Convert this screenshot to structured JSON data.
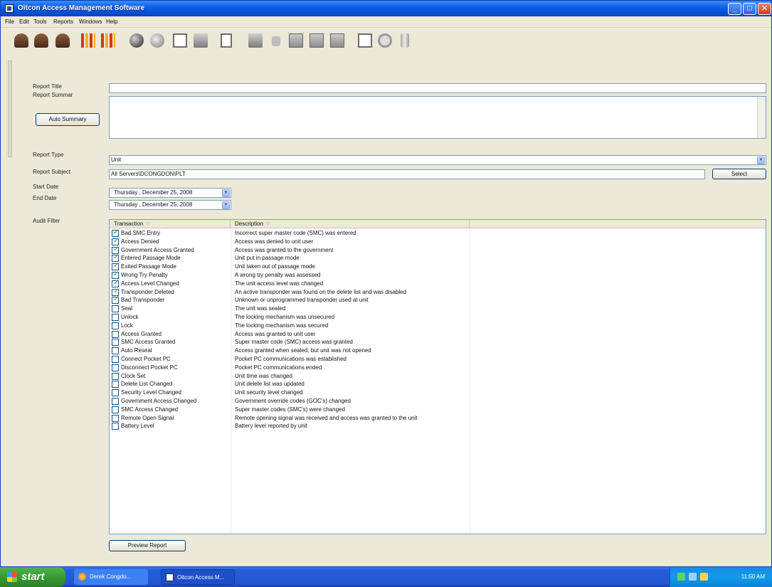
{
  "window": {
    "title": "Oitcon Access Management Software",
    "buttons": {
      "minimize": "_",
      "maximize": "□",
      "close": "✕"
    }
  },
  "menu": [
    "File",
    "Edit",
    "Tools",
    "Reports",
    "Windows",
    "Help"
  ],
  "toolbar": {
    "icons": [
      "users-icon",
      "user-icon",
      "user-remove-icon",
      "chart-icon",
      "chart-alt-icon",
      "globe-icon",
      "disc-icon",
      "document-icon",
      "document-dark-icon",
      "handheld-icon",
      "transfer-icon",
      "lock-icon",
      "server-icon",
      "server-add-icon",
      "server-list-icon",
      "window-icon",
      "settings-icon",
      "battery-icon"
    ]
  },
  "form": {
    "report_title_label": "Report Title",
    "report_title_value": "",
    "report_summary_label": "Report Summar",
    "report_summary_value": "",
    "auto_summary_button": "Auto Summary",
    "report_type_label": "Report Type",
    "report_type_value": "Unit",
    "report_subject_label": "Report Subject",
    "report_subject_value": "All Servers\\DCONGDON\\PLT",
    "select_button": "Select",
    "start_date_label": "Start Date",
    "start_date_value": "Thursday , December 25, 2008",
    "end_date_label": "End Date",
    "end_date_value": "Thursday , December 25, 2008",
    "audit_filter_label": "Audit Filter",
    "preview_button": "Preview Report"
  },
  "grid": {
    "columns": [
      "Transaction",
      "Description"
    ],
    "rows": [
      {
        "checked": true,
        "transaction": "Bad SMC Entry",
        "description": "Incorrect super master code (SMC) was entered"
      },
      {
        "checked": true,
        "transaction": "Access Denied",
        "description": "Access was denied to unit user"
      },
      {
        "checked": true,
        "transaction": "Government Access Granted",
        "description": "Access was granted to the government"
      },
      {
        "checked": true,
        "transaction": "Entered Passage Mode",
        "description": "Unit put in passage mode"
      },
      {
        "checked": true,
        "transaction": "Exited Passage Mode",
        "description": "Unit taken out of passage mode"
      },
      {
        "checked": true,
        "transaction": "Wrong Try Penalty",
        "description": "A wrong try penalty was assessed"
      },
      {
        "checked": true,
        "transaction": "Access Level Changed",
        "description": "The unit access level was changed"
      },
      {
        "checked": true,
        "transaction": "Transponder Deleted",
        "description": "An active transponder was found on the delete list and was disabled"
      },
      {
        "checked": true,
        "transaction": "Bad Transponder",
        "description": "Unknown or unprogrammed transponder used at unit"
      },
      {
        "checked": false,
        "transaction": "Seal",
        "description": "The unit was sealed"
      },
      {
        "checked": false,
        "transaction": "Unlock",
        "description": "The locking mechanism was unsecured"
      },
      {
        "checked": false,
        "transaction": "Lock",
        "description": "The locking mechanism was secured"
      },
      {
        "checked": false,
        "transaction": "Access Granted",
        "description": "Access was granted to unit user"
      },
      {
        "checked": false,
        "transaction": "SMC Access Granted",
        "description": "Super master code (SMC) access was granted"
      },
      {
        "checked": false,
        "transaction": "Auto Reseal",
        "description": "Access granted when sealed, but unit was not opened"
      },
      {
        "checked": false,
        "transaction": "Connect Pocket PC",
        "description": "Pocket PC communications was established"
      },
      {
        "checked": false,
        "transaction": "Disconnect Pocket PC",
        "description": "Pocket PC communications ended"
      },
      {
        "checked": false,
        "transaction": "Clock Set",
        "description": "Unit time was changed"
      },
      {
        "checked": false,
        "transaction": "Delete List Changed",
        "description": "Unit delete list was updated"
      },
      {
        "checked": false,
        "transaction": "Security Level Changed",
        "description": "Unit security level changed"
      },
      {
        "checked": false,
        "transaction": "Government Access Changed",
        "description": "Government override codes (GOC's) changed"
      },
      {
        "checked": false,
        "transaction": "SMC Access Changed",
        "description": "Super master codes (SMC's) were changed"
      },
      {
        "checked": false,
        "transaction": "Remote Open Signal",
        "description": "Remote opening signal was received and access was granted to the unit"
      },
      {
        "checked": false,
        "transaction": "Battery Level",
        "description": "Battery level reported by unit"
      }
    ]
  },
  "taskbar": {
    "start_label": "start",
    "tasks": [
      "Derek Congdo...",
      "Oitcon Access M..."
    ],
    "clock": "11:50 AM"
  },
  "colors": {
    "title_blue": "#0a5de8",
    "start_green": "#379a32",
    "check_green": "#21a121"
  }
}
